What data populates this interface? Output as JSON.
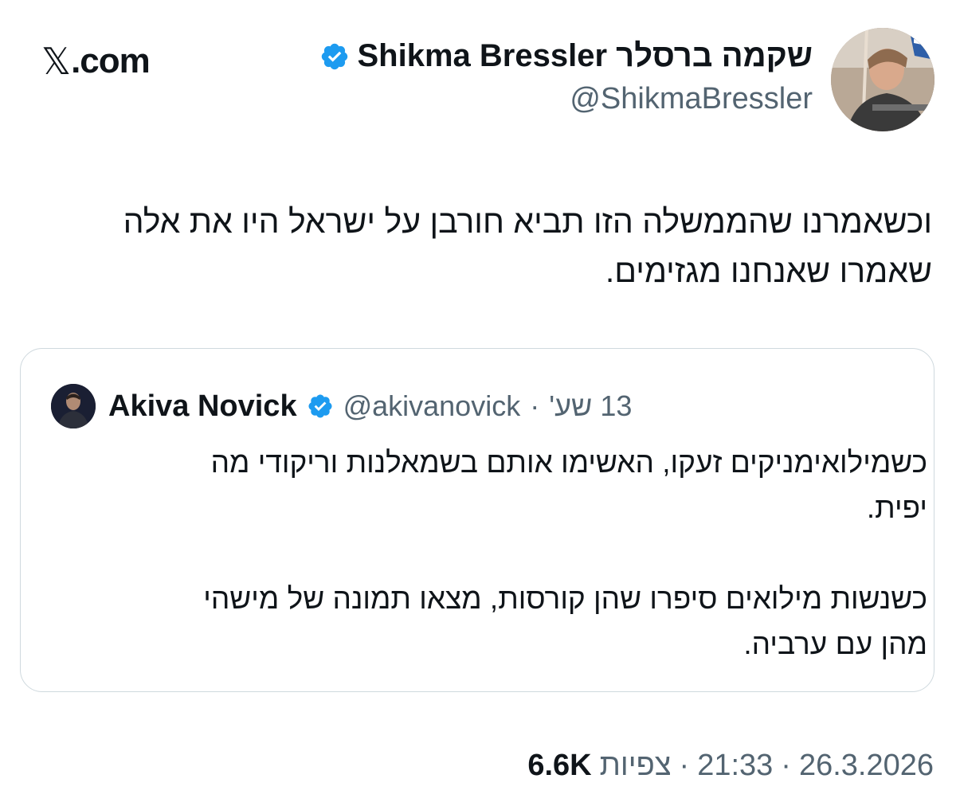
{
  "site": {
    "brand_mark": "𝕏",
    "brand_text": ".com"
  },
  "author": {
    "name": "Shikma Bressler שקמה ברסלר",
    "handle": "@ShikmaBressler",
    "verified_icon": "verified-badge-icon",
    "verified_color": "#1d9bf0"
  },
  "tweet": {
    "text_lines": [
      "וכשאמרנו שהממשלה הזו תביא חורבן על ישראל היו את אלה",
      "שאמרו שאנחנו מגזימים."
    ]
  },
  "quote": {
    "name": "Akiva Novick",
    "handle": "@akivanovick",
    "separator": "·",
    "time": "13 שע'",
    "paragraphs": [
      [
        "כשמילואימניקים זעקו, האשימו אותם בשמאלנות וריקודי מה",
        "יפית."
      ],
      [
        "כשנשות מילואים סיפרו שהן קורסות, מצאו תמונה של מישהי",
        "מהן עם ערביה."
      ]
    ]
  },
  "footer": {
    "date": "26.3.2026",
    "time": "21:33",
    "separator": "·",
    "views_count": "6.6K",
    "views_label": "צפיות"
  },
  "colors": {
    "text": "#0f1419",
    "secondary": "#536471",
    "border": "#cfd9de",
    "accent": "#1d9bf0"
  }
}
